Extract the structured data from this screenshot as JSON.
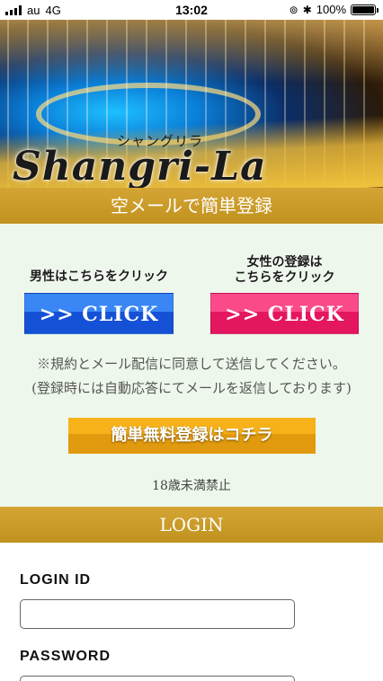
{
  "status_bar": {
    "carrier": "au",
    "network": "4G",
    "time": "13:02",
    "battery": "100%",
    "battery_level": 1.0
  },
  "hero": {
    "logo_sub": "シャングリラ",
    "logo_main": "Shangri-La"
  },
  "register_section": {
    "header": "空メールで簡単登録",
    "male_label_1": "男性はこちらをクリック",
    "male_button": ">> CLICK",
    "female_label_1": "女性の登録は",
    "female_label_2": "こちらをクリック",
    "female_button": ">> CLICK",
    "notice_1": "※規約とメール配信に同意して送信してください。",
    "notice_2": "(登録時には自動応答にてメールを返信しております)",
    "register_button": "簡単無料登録はコチラ",
    "age_note": "18歳未満禁止"
  },
  "login_section": {
    "header": "LOGIN",
    "login_id_label": "LOGIN ID",
    "login_id_value": "",
    "password_label": "PASSWORD",
    "password_value": ""
  },
  "colors": {
    "gold_header": "#c99a28",
    "male_blue": "#2a6de6",
    "female_pink": "#f0306f",
    "register_orange": "#efa514",
    "page_bg": "#eef7ec"
  }
}
